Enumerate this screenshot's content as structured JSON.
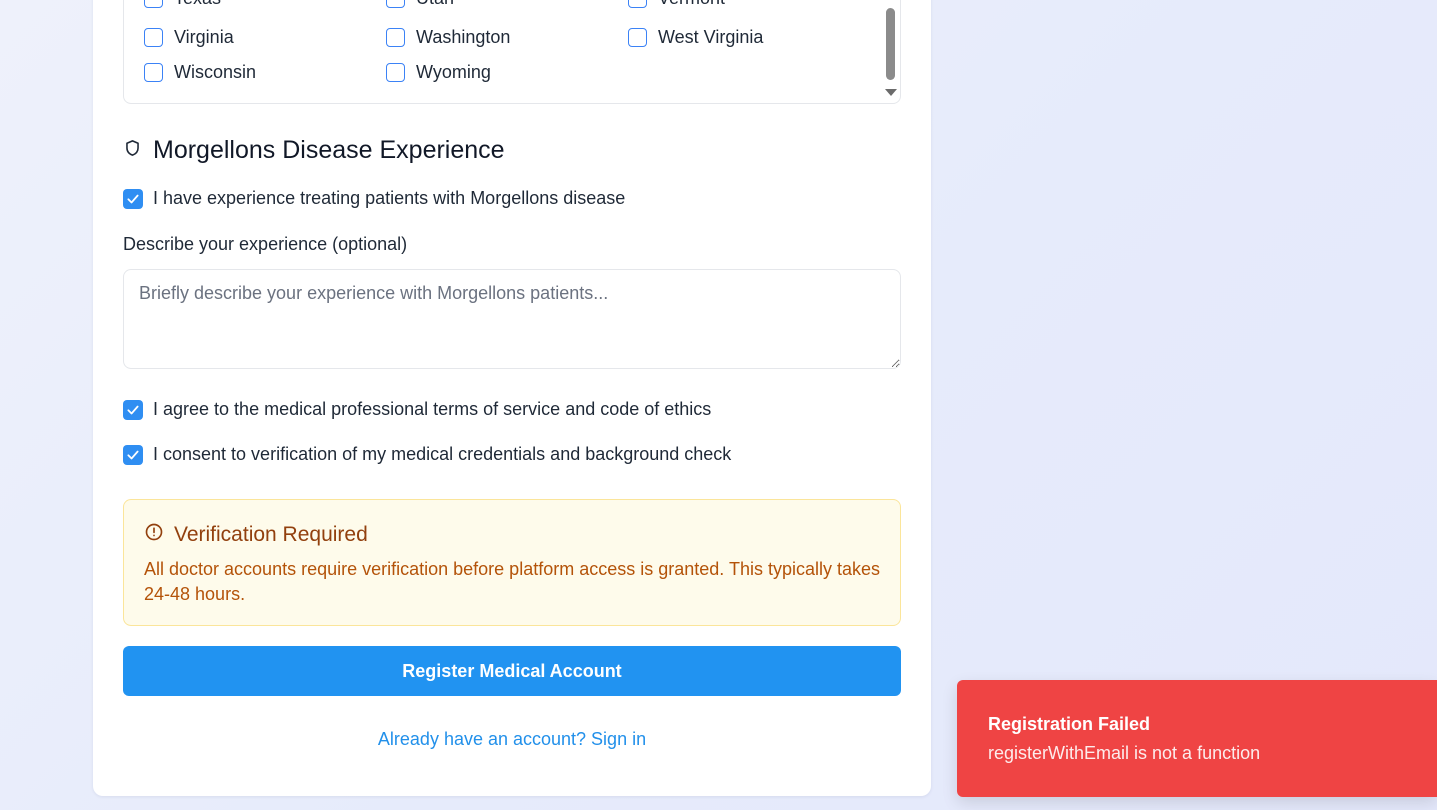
{
  "states": {
    "rows": [
      [
        "Texas",
        "Utah",
        "Vermont"
      ],
      [
        "Virginia",
        "Washington",
        "West Virginia"
      ],
      [
        "Wisconsin",
        "Wyoming"
      ]
    ]
  },
  "morgellons": {
    "title": "Morgellons Disease Experience",
    "experience_checkbox_label": "I have experience treating patients with Morgellons disease",
    "experience_checked": true,
    "describe_label": "Describe your experience (optional)",
    "describe_placeholder": "Briefly describe your experience with Morgellons patients...",
    "describe_value": ""
  },
  "agreements": {
    "terms_label": "I agree to the medical professional terms of service and code of ethics",
    "terms_checked": true,
    "consent_label": "I consent to verification of my medical credentials and background check",
    "consent_checked": true
  },
  "notice": {
    "title": "Verification Required",
    "text": "All doctor accounts require verification before platform access is granted. This typically takes 24-48 hours."
  },
  "actions": {
    "register_label": "Register Medical Account",
    "signin_label": "Already have an account? Sign in"
  },
  "toast": {
    "title": "Registration Failed",
    "message": "registerWithEmail is not a function"
  },
  "colors": {
    "accent": "#2193f1",
    "error": "#ef4444",
    "warning_bg": "#fefbeb",
    "warning_text": "#b45309"
  },
  "icons": {
    "section": "shield-icon",
    "notice": "alert-circle-icon",
    "checked": "check-icon"
  }
}
